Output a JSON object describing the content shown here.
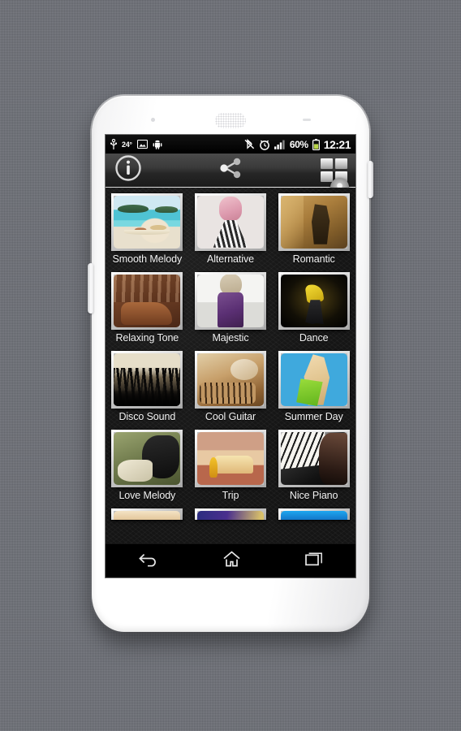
{
  "statusbar": {
    "temperature": "24°",
    "battery_percent": "60%",
    "clock": "12:21",
    "icons": [
      "usb-icon",
      "thermometer-icon",
      "screenshot-image-icon",
      "android-icon",
      "bluetooth-off-icon",
      "alarm-clock-icon",
      "signal-bars-icon",
      "battery-icon"
    ]
  },
  "actionbar": {
    "info_icon": "info-circle-icon",
    "share_icon": "share-icon",
    "grid_icon": "grid-view-icon",
    "scroll_handle": "scroll-thumb-handle"
  },
  "grid": {
    "items": [
      {
        "label": "Smooth Melody",
        "art": "art-beach"
      },
      {
        "label": "Alternative",
        "art": "art-alt"
      },
      {
        "label": "Romantic",
        "art": "art-romantic"
      },
      {
        "label": "Relaxing Tone",
        "art": "art-relax"
      },
      {
        "label": "Majestic",
        "art": "art-majestic"
      },
      {
        "label": "Dance",
        "art": "art-dance"
      },
      {
        "label": "Disco Sound",
        "art": "art-disco"
      },
      {
        "label": "Cool Guitar",
        "art": "art-guitar"
      },
      {
        "label": "Summer Day",
        "art": "art-summer"
      },
      {
        "label": "Love Melody",
        "art": "art-love"
      },
      {
        "label": "Trip",
        "art": "art-trip"
      },
      {
        "label": "Nice Piano",
        "art": "art-piano"
      }
    ],
    "clipped_row": [
      {
        "label": "",
        "art": "art-c1"
      },
      {
        "label": "",
        "art": "art-c2"
      },
      {
        "label": "",
        "art": "art-c3"
      }
    ]
  },
  "navbar": {
    "back_icon": "back-arrow-icon",
    "home_icon": "home-icon",
    "recents_icon": "recent-apps-icon"
  },
  "colors": {
    "page_background": "#6d7077",
    "phone_body": "#ffffff",
    "screen_background": "#151515",
    "statusbar_background": "#000000",
    "actionbar_top": "#4b4b4b",
    "label_text": "#f4f4f4",
    "thumb_border": "#d2d2d2"
  }
}
